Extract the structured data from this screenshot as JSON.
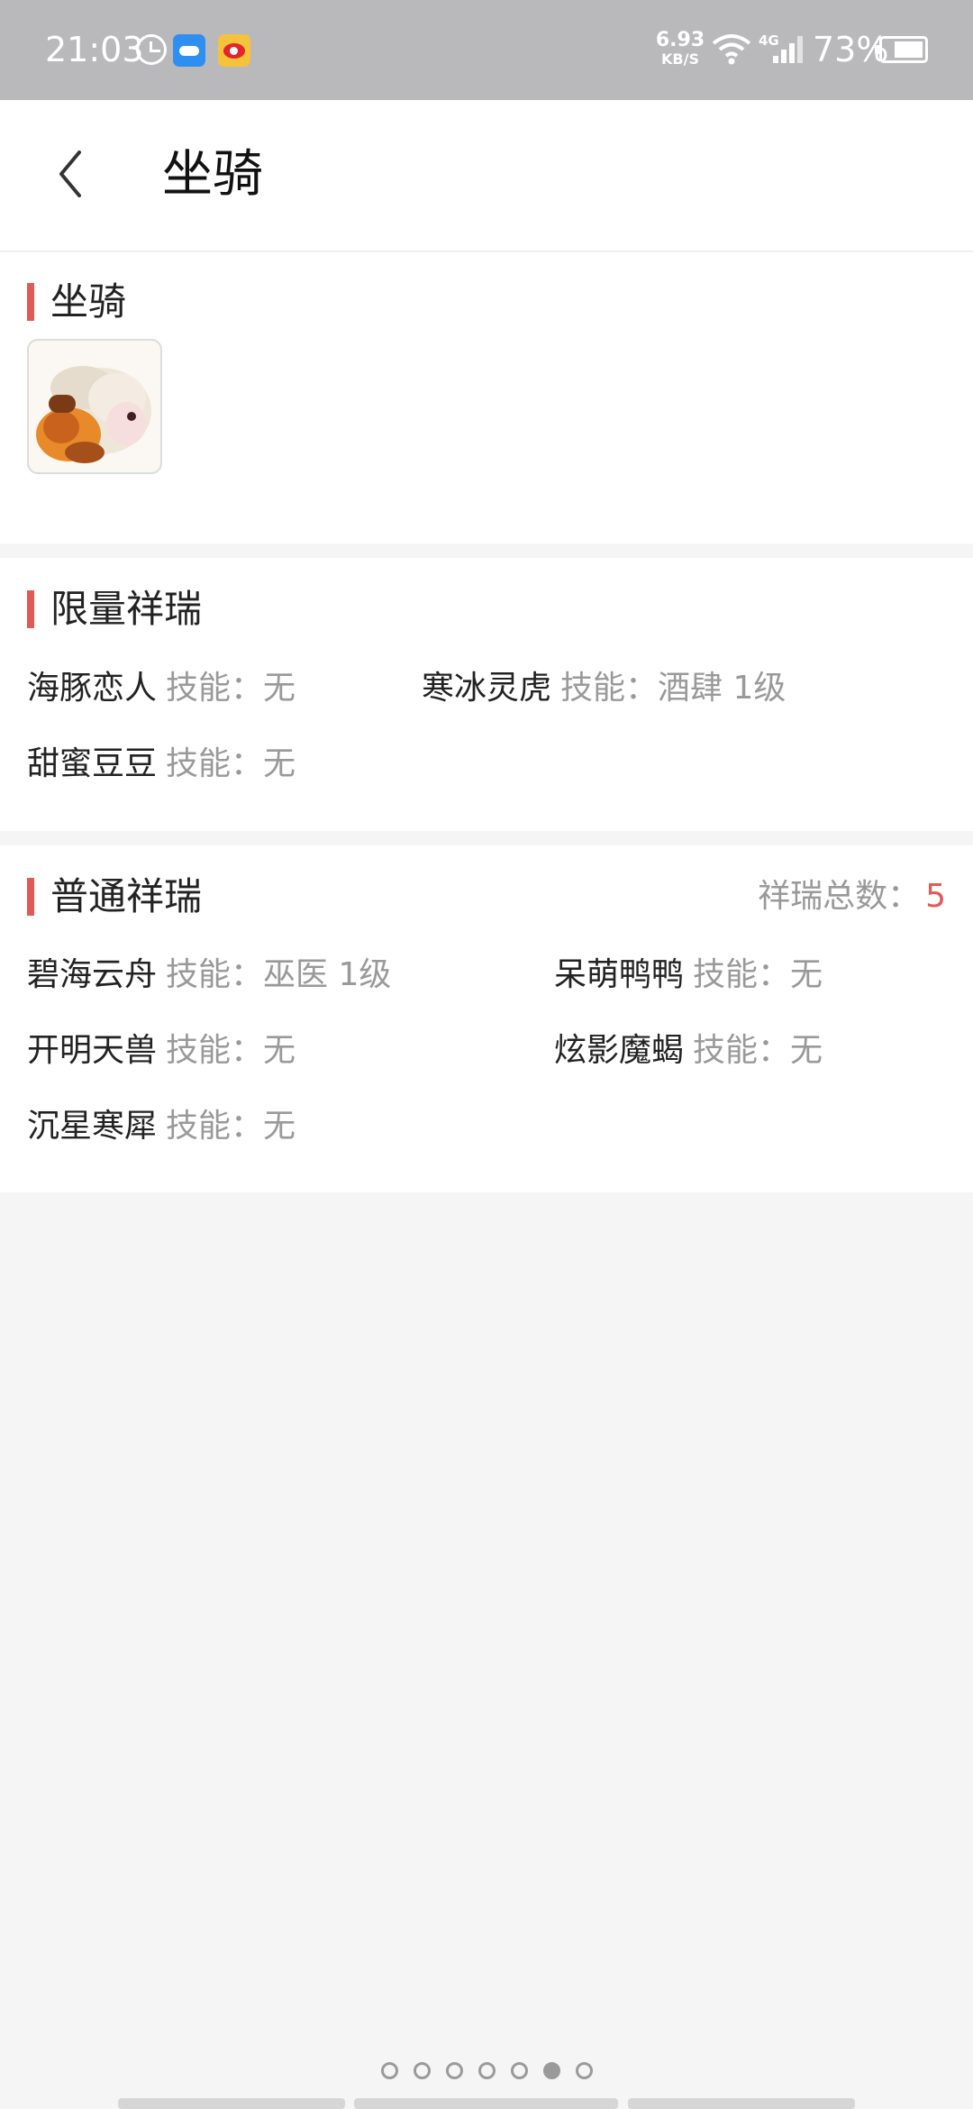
{
  "status_bar": {
    "time": "21:03",
    "net_speed_value": "6.93",
    "net_speed_unit": "KB/S",
    "network": "4G",
    "battery": "73%",
    "battery_level": 0.73
  },
  "header": {
    "title": "坐骑"
  },
  "mount_section": {
    "title": "坐骑"
  },
  "limited_section": {
    "title": "限量祥瑞",
    "items": [
      {
        "name": "海豚恋人",
        "skill": "技能：无"
      },
      {
        "name": "寒冰灵虎",
        "skill": "技能：酒肆 1级"
      },
      {
        "name": "甜蜜豆豆",
        "skill": "技能：无"
      }
    ]
  },
  "normal_section": {
    "title": "普通祥瑞",
    "count_label": "祥瑞总数：",
    "count_value": "5",
    "items": [
      {
        "name": "碧海云舟",
        "skill": "技能：巫医 1级"
      },
      {
        "name": "呆萌鸭鸭",
        "skill": "技能：无"
      },
      {
        "name": "开明天兽",
        "skill": "技能：无"
      },
      {
        "name": "炫影魔蝎",
        "skill": "技能：无"
      },
      {
        "name": "沉星寒犀",
        "skill": "技能：无"
      }
    ]
  },
  "pager": {
    "total": 7,
    "active_index": 5
  },
  "colors": {
    "accent": "#e05a56",
    "status_bar_bg": "#b9b8bb",
    "page_bg": "#f5f5f5"
  }
}
